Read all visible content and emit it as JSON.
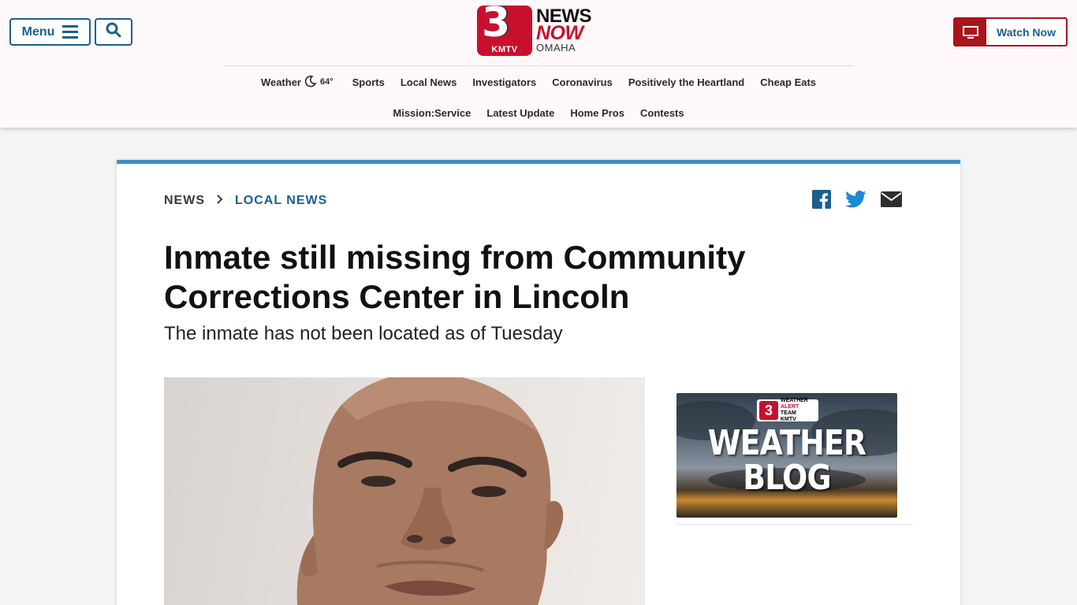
{
  "header": {
    "menu_label": "Menu",
    "logo": {
      "number": "3",
      "callsign": "KMTV",
      "line1": "NEWS",
      "line2": "NOW",
      "line3": "OMAHA"
    },
    "watch_label": "Watch Now",
    "weather": {
      "label": "Weather",
      "temp": "64°"
    },
    "nav_row1": [
      "Sports",
      "Local News",
      "Investigators",
      "Coronavirus",
      "Positively the Heartland",
      "Cheap Eats"
    ],
    "nav_row2": [
      "Mission:Service",
      "Latest Update",
      "Home Pros",
      "Contests"
    ]
  },
  "article": {
    "breadcrumb": {
      "section": "NEWS",
      "subsection": "LOCAL NEWS"
    },
    "headline": "Inmate still missing from Community Corrections Center in Lincoln",
    "subhead": "The inmate has not been located as of Tuesday"
  },
  "sidebar": {
    "promo": {
      "badge_number": "3",
      "badge_line1": "WEATHER",
      "badge_line2": "ALERT",
      "badge_line3": "TEAM",
      "badge_callsign": "KMTV",
      "title_line1": "WEATHER",
      "title_line2": "BLOG"
    }
  },
  "colors": {
    "brand_red": "#c8102e",
    "link_blue": "#1a5f8f",
    "card_accent": "#3f8dc6"
  }
}
